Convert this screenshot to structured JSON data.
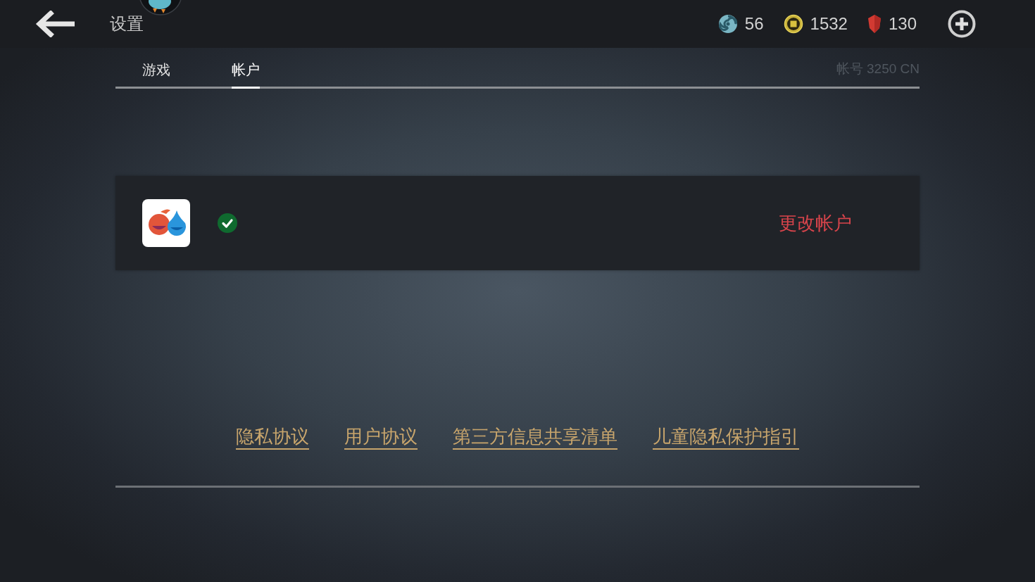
{
  "top_bar": {
    "title": "设置",
    "currencies": [
      {
        "kind": "swirl",
        "amount": "56"
      },
      {
        "kind": "coin",
        "amount": "1532"
      },
      {
        "kind": "gem",
        "amount": "130"
      }
    ]
  },
  "tabs": [
    {
      "label": "游戏",
      "selected": false
    },
    {
      "label": "帐户",
      "selected": true
    }
  ],
  "account_id": "帐号 3250 CN",
  "account_card": {
    "verified": true,
    "change_label": "更改帐户"
  },
  "links": [
    "隐私协议",
    "用户协议",
    "第三方信息共享清单",
    "儿童隐私保护指引"
  ]
}
